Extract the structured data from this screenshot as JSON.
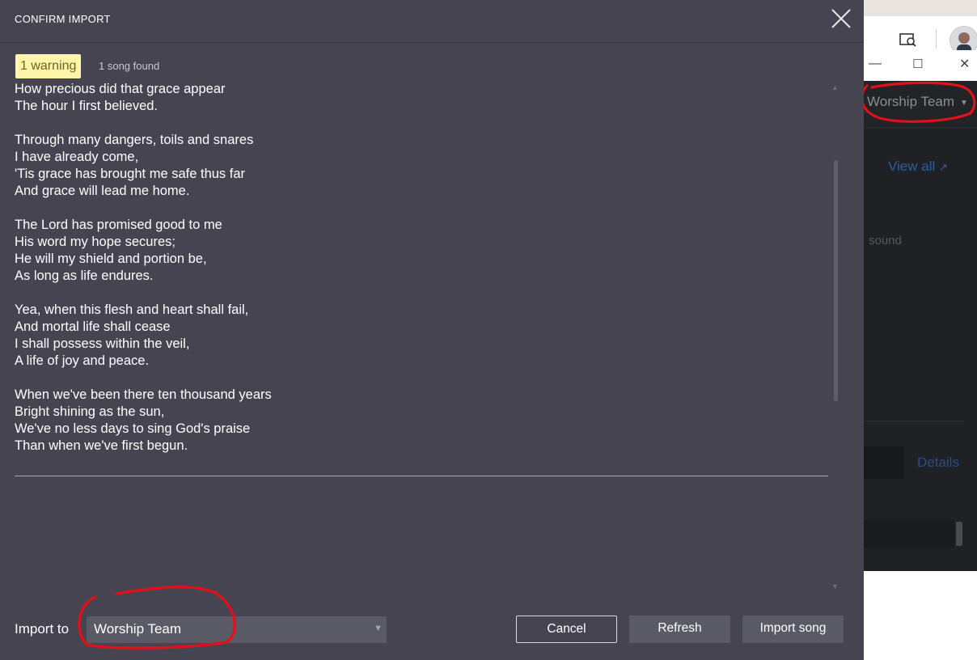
{
  "dialog": {
    "title": "CONFIRM IMPORT",
    "close_icon": "close-icon",
    "warning_badge": "1 warning",
    "songs_found": "1 song found",
    "lyrics": "How precious did that grace appear\nThe hour I first believed.\n\nThrough many dangers, toils and snares\nI have already come,\n'Tis grace has brought me safe thus far\nAnd grace will lead me home.\n\nThe Lord has promised good to me\nHis word my hope secures;\nHe will my shield and portion be,\nAs long as life endures.\n\nYea, when this flesh and heart shall fail,\nAnd mortal life shall cease\nI shall possess within the veil,\nA life of joy and peace.\n\nWhen we've been there ten thousand years\nBright shining as the sun,\nWe've no less days to sing God's praise\nThan when we've first begun.",
    "import_to_label": "Import to",
    "import_to_value": "Worship Team",
    "buttons": {
      "cancel": "Cancel",
      "refresh": "Refresh",
      "import": "Import song"
    }
  },
  "background_app": {
    "team_selector": "Worship Team",
    "view_all_link": "View all",
    "partial_text": "sound",
    "details_link": "Details"
  },
  "colors": {
    "dialog_bg": "#454450",
    "warning_bg": "#fff4a8",
    "annotation_red": "#e0111a"
  }
}
